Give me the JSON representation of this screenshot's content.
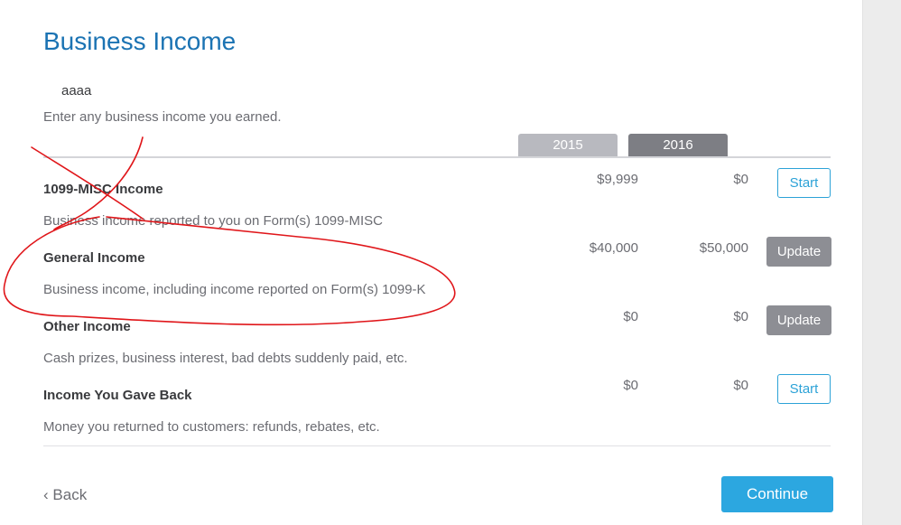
{
  "page": {
    "title": "Business Income",
    "note": "aaaa",
    "subtitle": "Enter any business income you earned."
  },
  "years": [
    "2015",
    "2016"
  ],
  "rows": [
    {
      "title": "1099-MISC Income",
      "description": "Business income reported to you on Form(s) 1099-MISC",
      "amount_2015": "$9,999",
      "amount_2016": "$0",
      "action": "Start"
    },
    {
      "title": "General Income",
      "description": "Business income, including income reported on Form(s) 1099-K",
      "amount_2015": "$40,000",
      "amount_2016": "$50,000",
      "action": "Update"
    },
    {
      "title": "Other Income",
      "description": "Cash prizes, business interest, bad debts suddenly paid, etc.",
      "amount_2015": "$0",
      "amount_2016": "$0",
      "action": "Update"
    },
    {
      "title": "Income You Gave Back",
      "description": "Money you returned to customers: refunds, rebates, etc.",
      "amount_2015": "$0",
      "amount_2016": "$0",
      "action": "Start"
    }
  ],
  "footer": {
    "back_label": "Back",
    "back_icon": "chevron-left-icon",
    "continue_label": "Continue"
  },
  "colors": {
    "title_blue": "#1b73b3",
    "accent": "#2ca7e0",
    "update_gray": "#8d8e94",
    "annotation_red": "#e0161a"
  }
}
